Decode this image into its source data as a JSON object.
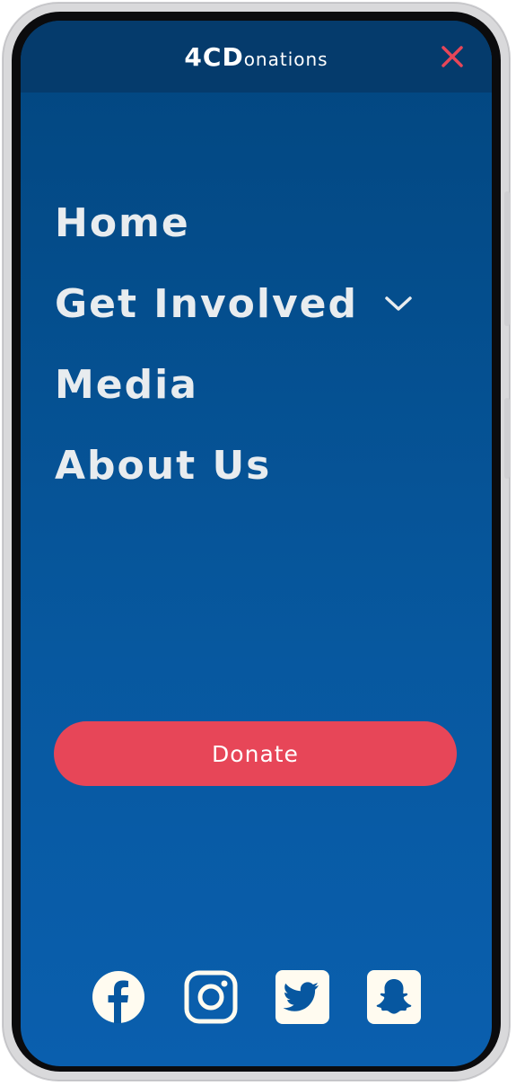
{
  "header": {
    "logo_strong": "4CD",
    "logo_rest": "onations",
    "close_icon": "close-icon"
  },
  "nav": {
    "items": [
      {
        "label": "Home"
      },
      {
        "label": "Get Involved",
        "icon": "chevron-down-icon"
      },
      {
        "label": "Media"
      },
      {
        "label": "About Us"
      }
    ]
  },
  "donate": {
    "label": "Donate"
  },
  "social": [
    {
      "icon": "facebook-icon"
    },
    {
      "icon": "instagram-icon"
    },
    {
      "icon": "twitter-icon"
    },
    {
      "icon": "snapchat-icon"
    }
  ],
  "colors": {
    "background_top": "#02467f",
    "background_bottom": "#0a5fae",
    "header_bar": "#053b6c",
    "accent_red": "#e74658",
    "nav_text": "#e8ecef",
    "icon_fill": "#fffbf0"
  }
}
